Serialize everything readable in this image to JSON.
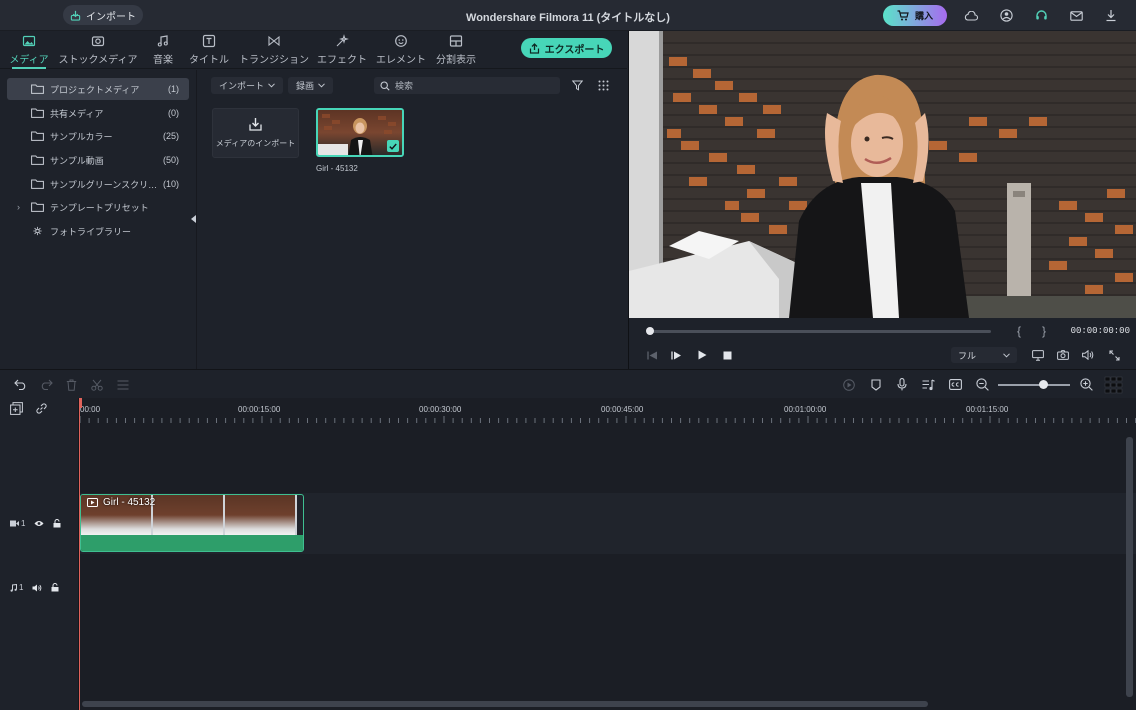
{
  "window": {
    "title": "Wondershare Filmora 11 (タイトルなし)",
    "import_button": "インポート",
    "buy_button": "購入"
  },
  "tabs": [
    {
      "label": "メディア",
      "icon": "media-icon",
      "active": true
    },
    {
      "label": "ストックメディア",
      "icon": "stock-media-icon"
    },
    {
      "label": "音楽",
      "icon": "music-icon"
    },
    {
      "label": "タイトル",
      "icon": "title-icon"
    },
    {
      "label": "トランジション",
      "icon": "transition-icon"
    },
    {
      "label": "エフェクト",
      "icon": "effect-icon"
    },
    {
      "label": "エレメント",
      "icon": "element-icon"
    },
    {
      "label": "分割表示",
      "icon": "split-screen-icon"
    }
  ],
  "export_button": "エクスポート",
  "sidebar": {
    "items": [
      {
        "label": "プロジェクトメディア",
        "count": "(1)",
        "active": true
      },
      {
        "label": "共有メディア",
        "count": "(0)"
      },
      {
        "label": "サンプルカラー",
        "count": "(25)"
      },
      {
        "label": "サンプル動画",
        "count": "(50)"
      },
      {
        "label": "サンプルグリーンスクリ…",
        "count": "(10)"
      },
      {
        "label": "テンプレートプリセット",
        "count": ""
      },
      {
        "label": "フォトライブラリー",
        "count": ""
      }
    ]
  },
  "filters": {
    "import_dropdown": "インポート",
    "record_dropdown": "録画",
    "search_placeholder": "検索"
  },
  "media": {
    "import_tile_label": "メディアのインポート",
    "items": [
      {
        "name": "Girl - 45132",
        "selected": true
      }
    ]
  },
  "preview": {
    "timecode": "00:00:00:00",
    "quality": "フル",
    "bracket_in": "{",
    "bracket_out": "}",
    "progress": 0.0
  },
  "timeline": {
    "ruler_labels": [
      "00:00",
      "00:00:15:00",
      "00:00:30:00",
      "00:00:45:00",
      "00:01:00:00",
      "00:01:15:00"
    ],
    "video_track_label": "1",
    "audio_track_label": "1",
    "clip_title": "Girl - 45132",
    "zoom_level": 0.6
  },
  "colors": {
    "accent": "#47d6b8",
    "playhead": "#e0635b",
    "clip_audio": "#2e9e6a"
  }
}
